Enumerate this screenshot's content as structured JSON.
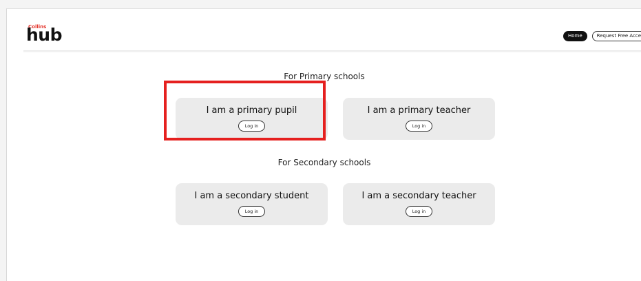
{
  "header": {
    "logo_brand": "Collins",
    "logo_word": "hub",
    "nav": {
      "home_label": "Home",
      "request_label": "Request Free Access"
    }
  },
  "primary": {
    "heading": "For Primary schools",
    "cards": [
      {
        "title": "I am a primary pupil",
        "button": "Log in"
      },
      {
        "title": "I am a primary teacher",
        "button": "Log in"
      }
    ]
  },
  "secondary": {
    "heading": "For Secondary schools",
    "cards": [
      {
        "title": "I am a secondary student",
        "button": "Log in"
      },
      {
        "title": "I am a secondary teacher",
        "button": "Log in"
      }
    ]
  },
  "colors": {
    "highlight": "#e5201f",
    "brand": "#e4332a",
    "card_bg": "#ebebeb"
  }
}
